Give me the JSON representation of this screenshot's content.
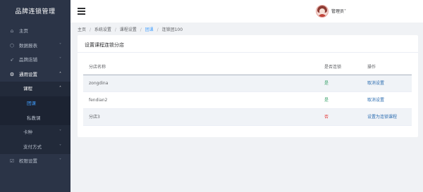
{
  "app": {
    "title": "品牌连锁管理"
  },
  "sidebar": {
    "items": [
      {
        "label": "主页",
        "icon": "home-icon"
      },
      {
        "label": "数据报表",
        "icon": "cube-icon",
        "chevron": "˅"
      },
      {
        "label": "品牌店铺",
        "icon": "rocket-icon",
        "chevron": "˅"
      },
      {
        "label": "通用设置",
        "icon": "gear-icon",
        "chevron": "˄"
      },
      {
        "label": "课程",
        "chevron": "˄"
      },
      {
        "label": "团课"
      },
      {
        "label": "私教课"
      },
      {
        "label": "卡种",
        "chevron": "˅"
      },
      {
        "label": "支付方式",
        "chevron": "˅"
      },
      {
        "label": "权限设置",
        "icon": "checkbox-icon",
        "chevron": "˅"
      }
    ]
  },
  "header": {
    "username": "管理员",
    "username_chevron": "˅"
  },
  "breadcrumb": {
    "items": [
      "主页",
      "系统设置",
      "课程设置",
      "团课",
      "连锁团100"
    ],
    "separator": "/"
  },
  "card": {
    "title": "设置课程连锁分店"
  },
  "table": {
    "headers": [
      "分店名称",
      "是否连锁",
      "操作"
    ],
    "rows": [
      {
        "name": "zongdina",
        "chain": "是",
        "action": "取消设置"
      },
      {
        "name": "fendian2",
        "chain": "是",
        "action": "取消设置"
      },
      {
        "name": "分店3",
        "chain": "否",
        "action": "设置为连锁课程"
      }
    ]
  },
  "colors": {
    "sidebar_bg": "#2b3447",
    "accent": "#409eff",
    "yes": "#38a169",
    "no": "#e53e3e",
    "link": "#2b6cb0"
  }
}
